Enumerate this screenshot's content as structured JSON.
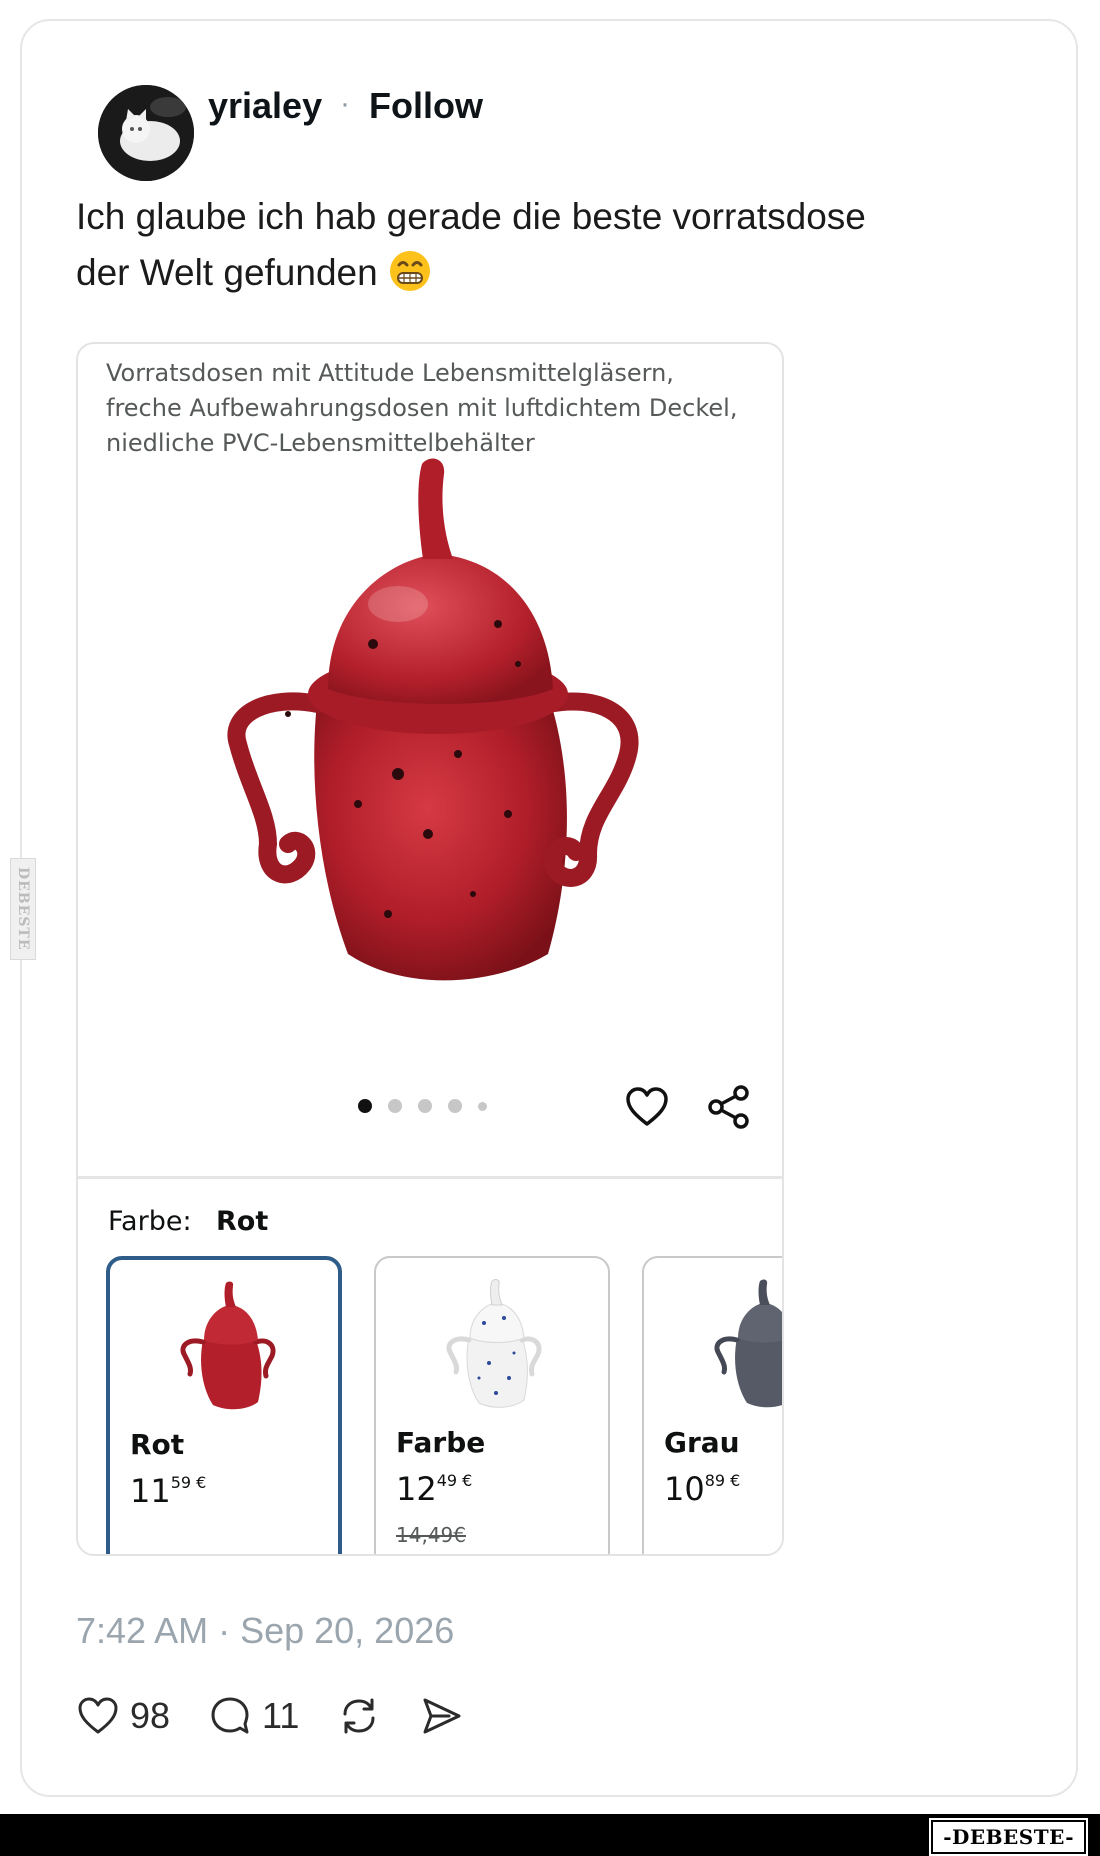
{
  "post": {
    "username": "yrialey",
    "separator": "·",
    "follow_label": "Follow",
    "text_line1": "Ich glaube ich hab gerade die beste vorratsdose",
    "text_line2": "der Welt gefunden",
    "emoji": "grinning-face-emoji",
    "timestamp": "7:42 AM · Sep 20, 2026"
  },
  "embed": {
    "title": "Vorratsdosen mit Attitude Lebensmittelgläsern, freche Aufbewahrungsdosen mit luftdichtem Deckel, niedliche PVC-Lebensmittelbehälter",
    "image_count": 5,
    "active_image": 1,
    "color_label": "Farbe:",
    "color_value": "Rot",
    "variants": [
      {
        "name": "Rot",
        "price_main": "11",
        "price_cents": "59 €",
        "selected": true,
        "color": "#b8202a"
      },
      {
        "name": "Farbe",
        "price_main": "12",
        "price_cents": "49 €",
        "old_price": "14,49€",
        "color": "#f2f2f2"
      },
      {
        "name": "Grau",
        "price_main": "10",
        "price_cents": "89 €",
        "color": "#555a66"
      }
    ]
  },
  "stats": {
    "likes": "98",
    "replies": "11"
  },
  "watermark": {
    "side_text": "DEBESTE",
    "badge_text": "-DEBESTE-"
  },
  "colors": {
    "product_red": "#b8202a",
    "selected_border": "#2f5d8a",
    "timestamp_gray": "#9aa5ae"
  }
}
